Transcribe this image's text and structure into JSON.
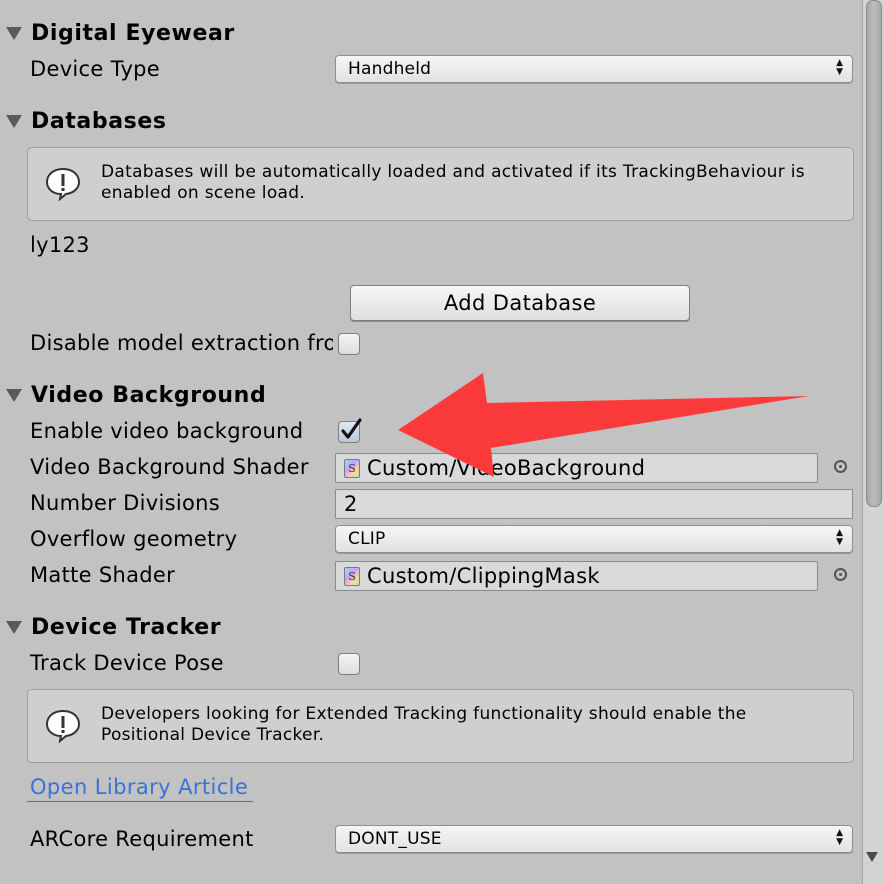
{
  "sections": {
    "digital_eyewear": "Digital Eyewear",
    "databases": "Databases",
    "video_background": "Video Background",
    "device_tracker": "Device Tracker"
  },
  "digital_eyewear": {
    "device_type_label": "Device Type",
    "device_type_value": "Handheld"
  },
  "databases": {
    "help_text": "Databases will be automatically loaded and activated if its TrackingBehaviour is enabled on scene load.",
    "database_name": "ly123",
    "add_button": "Add Database",
    "disable_extraction_label": "Disable model extraction fro",
    "disable_extraction_checked": false
  },
  "video_background": {
    "enable_label": "Enable video background",
    "enable_checked": true,
    "shader_label": "Video Background Shader",
    "shader_value": "Custom/VideoBackground",
    "divisions_label": "Number Divisions",
    "divisions_value": "2",
    "overflow_label": "Overflow geometry",
    "overflow_value": "CLIP",
    "matte_label": "Matte Shader",
    "matte_value": "Custom/ClippingMask",
    "shader_icon_glyph": "S"
  },
  "device_tracker": {
    "track_pose_label": "Track Device Pose",
    "track_pose_checked": false,
    "help_text": "Developers looking for Extended Tracking functionality should enable the Positional Device Tracker.",
    "link_text": "Open Library Article",
    "arcore_label": "ARCore Requirement",
    "arcore_value": "DONT_USE"
  },
  "annotation": {
    "arrow_color": "#fb3b3b"
  },
  "icons": {
    "help": "exclamation-speech-icon",
    "dropdown": "up-down-arrows-icon",
    "object_picker": "object-picker-icon"
  }
}
